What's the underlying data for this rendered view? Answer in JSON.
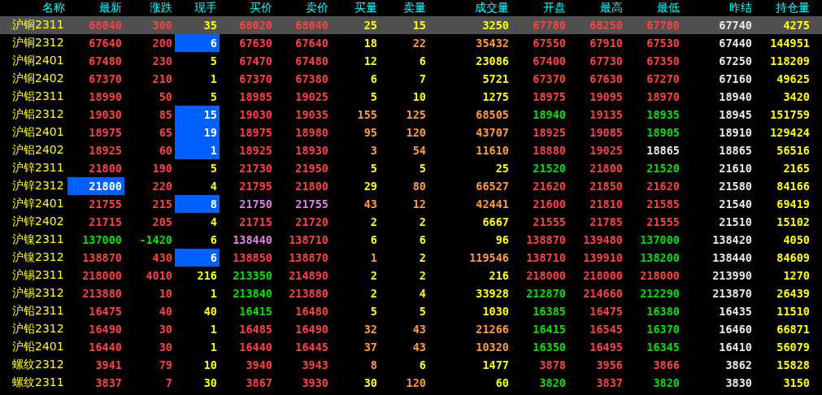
{
  "columns": [
    "名称",
    "最新",
    "涨跌",
    "现手",
    "买价",
    "卖价",
    "买量",
    "卖量",
    "成交量",
    "开盘",
    "最高",
    "最低",
    "昨结",
    "持仓量"
  ],
  "rows": [
    {
      "selected": true,
      "cells": [
        {
          "text": "沪铜2311"
        },
        {
          "text": "68040",
          "color": "#ff4040"
        },
        {
          "text": "300",
          "color": "#ff4040"
        },
        {
          "text": "35",
          "color": "#ffff00"
        },
        {
          "text": "68020",
          "color": "#ff4040"
        },
        {
          "text": "68040",
          "color": "#ff4040"
        },
        {
          "text": "25",
          "color": "#ffff00"
        },
        {
          "text": "15",
          "color": "#ffff00"
        },
        {
          "text": "3250",
          "color": "#ffff00"
        },
        {
          "text": "67780",
          "color": "#ff4040"
        },
        {
          "text": "68250",
          "color": "#ff4040"
        },
        {
          "text": "67780",
          "color": "#ff4040"
        },
        {
          "text": "67740",
          "color": "#e8e8e8"
        },
        {
          "text": "4275",
          "color": "#ffff00"
        }
      ]
    },
    {
      "selected": false,
      "cells": [
        {
          "text": "沪铜2312"
        },
        {
          "text": "67640",
          "color": "#ff4040"
        },
        {
          "text": "200",
          "color": "#ff4040"
        },
        {
          "text": "6",
          "flash": true
        },
        {
          "text": "67630",
          "color": "#ff4040"
        },
        {
          "text": "67640",
          "color": "#ff4040"
        },
        {
          "text": "18",
          "color": "#ffff00"
        },
        {
          "text": "22",
          "color": "#ff9a40"
        },
        {
          "text": "35432",
          "color": "#ff9a40"
        },
        {
          "text": "67550",
          "color": "#ff4040"
        },
        {
          "text": "67910",
          "color": "#ff4040"
        },
        {
          "text": "67530",
          "color": "#ff4040"
        },
        {
          "text": "67440",
          "color": "#e8e8e8"
        },
        {
          "text": "144951",
          "color": "#ffff00"
        }
      ]
    },
    {
      "selected": false,
      "cells": [
        {
          "text": "沪铜2401"
        },
        {
          "text": "67480",
          "color": "#ff4040"
        },
        {
          "text": "230",
          "color": "#ff4040"
        },
        {
          "text": "5",
          "color": "#ffff00"
        },
        {
          "text": "67470",
          "color": "#ff4040"
        },
        {
          "text": "67480",
          "color": "#ff4040"
        },
        {
          "text": "12",
          "color": "#ffff00"
        },
        {
          "text": "6",
          "color": "#ffff00"
        },
        {
          "text": "23086",
          "color": "#ffff00"
        },
        {
          "text": "67400",
          "color": "#ff4040"
        },
        {
          "text": "67730",
          "color": "#ff4040"
        },
        {
          "text": "67350",
          "color": "#ff4040"
        },
        {
          "text": "67250",
          "color": "#e8e8e8"
        },
        {
          "text": "118209",
          "color": "#ffff00"
        }
      ]
    },
    {
      "selected": false,
      "cells": [
        {
          "text": "沪铜2402"
        },
        {
          "text": "67370",
          "color": "#ff4040"
        },
        {
          "text": "210",
          "color": "#ff4040"
        },
        {
          "text": "1",
          "color": "#ffff00"
        },
        {
          "text": "67370",
          "color": "#ff4040"
        },
        {
          "text": "67380",
          "color": "#ff4040"
        },
        {
          "text": "6",
          "color": "#ffff00"
        },
        {
          "text": "7",
          "color": "#ffff00"
        },
        {
          "text": "5721",
          "color": "#ffff00"
        },
        {
          "text": "67370",
          "color": "#ff4040"
        },
        {
          "text": "67630",
          "color": "#ff4040"
        },
        {
          "text": "67270",
          "color": "#ff4040"
        },
        {
          "text": "67160",
          "color": "#e8e8e8"
        },
        {
          "text": "49625",
          "color": "#ffff00"
        }
      ]
    },
    {
      "selected": false,
      "cells": [
        {
          "text": "沪铝2311"
        },
        {
          "text": "18990",
          "color": "#ff4040"
        },
        {
          "text": "50",
          "color": "#ff4040"
        },
        {
          "text": "5",
          "color": "#ffff00"
        },
        {
          "text": "18985",
          "color": "#ff4040"
        },
        {
          "text": "19025",
          "color": "#ff4040"
        },
        {
          "text": "5",
          "color": "#ffff00"
        },
        {
          "text": "10",
          "color": "#ffff00"
        },
        {
          "text": "1275",
          "color": "#ffff00"
        },
        {
          "text": "18975",
          "color": "#ff4040"
        },
        {
          "text": "19095",
          "color": "#ff4040"
        },
        {
          "text": "18970",
          "color": "#ff4040"
        },
        {
          "text": "18940",
          "color": "#e8e8e8"
        },
        {
          "text": "3420",
          "color": "#ffff00"
        }
      ]
    },
    {
      "selected": false,
      "cells": [
        {
          "text": "沪铝2312"
        },
        {
          "text": "19030",
          "color": "#ff4040"
        },
        {
          "text": "85",
          "color": "#ff4040"
        },
        {
          "text": "15",
          "flash": true
        },
        {
          "text": "19030",
          "color": "#ff4040"
        },
        {
          "text": "19035",
          "color": "#ff4040"
        },
        {
          "text": "155",
          "color": "#ff9a40"
        },
        {
          "text": "125",
          "color": "#ff9a40"
        },
        {
          "text": "68505",
          "color": "#ff9a40"
        },
        {
          "text": "18940",
          "color": "#00e000"
        },
        {
          "text": "19135",
          "color": "#ff4040"
        },
        {
          "text": "18935",
          "color": "#00e000"
        },
        {
          "text": "18945",
          "color": "#e8e8e8"
        },
        {
          "text": "151759",
          "color": "#ffff00"
        }
      ]
    },
    {
      "selected": false,
      "cells": [
        {
          "text": "沪铝2401"
        },
        {
          "text": "18975",
          "color": "#ff4040"
        },
        {
          "text": "65",
          "color": "#ff4040"
        },
        {
          "text": "19",
          "flash": true
        },
        {
          "text": "18975",
          "color": "#ff4040"
        },
        {
          "text": "18980",
          "color": "#ff4040"
        },
        {
          "text": "95",
          "color": "#ff9a40"
        },
        {
          "text": "120",
          "color": "#ff9a40"
        },
        {
          "text": "43707",
          "color": "#ff9a40"
        },
        {
          "text": "18925",
          "color": "#ff4040"
        },
        {
          "text": "19085",
          "color": "#ff4040"
        },
        {
          "text": "18905",
          "color": "#00e000"
        },
        {
          "text": "18910",
          "color": "#e8e8e8"
        },
        {
          "text": "129424",
          "color": "#ffff00"
        }
      ]
    },
    {
      "selected": false,
      "cells": [
        {
          "text": "沪铝2402"
        },
        {
          "text": "18925",
          "color": "#ff4040"
        },
        {
          "text": "60",
          "color": "#ff4040"
        },
        {
          "text": "1",
          "flash": true
        },
        {
          "text": "18925",
          "color": "#ff4040"
        },
        {
          "text": "18930",
          "color": "#ff4040"
        },
        {
          "text": "3",
          "color": "#ff9a40"
        },
        {
          "text": "54",
          "color": "#ff9a40"
        },
        {
          "text": "11610",
          "color": "#ff9a40"
        },
        {
          "text": "18880",
          "color": "#ff4040"
        },
        {
          "text": "19025",
          "color": "#ff4040"
        },
        {
          "text": "18865",
          "color": "#e8e8e8"
        },
        {
          "text": "18865",
          "color": "#e8e8e8"
        },
        {
          "text": "56516",
          "color": "#ffff00"
        }
      ]
    },
    {
      "selected": false,
      "cells": [
        {
          "text": "沪锌2311"
        },
        {
          "text": "21800",
          "color": "#ff4040"
        },
        {
          "text": "190",
          "color": "#ff4040"
        },
        {
          "text": "5",
          "color": "#ffff00"
        },
        {
          "text": "21730",
          "color": "#ff4040"
        },
        {
          "text": "21950",
          "color": "#ff4040"
        },
        {
          "text": "5",
          "color": "#ffff00"
        },
        {
          "text": "5",
          "color": "#ffff00"
        },
        {
          "text": "25",
          "color": "#ffff00"
        },
        {
          "text": "21520",
          "color": "#00e000"
        },
        {
          "text": "21800",
          "color": "#ff4040"
        },
        {
          "text": "21520",
          "color": "#00e000"
        },
        {
          "text": "21610",
          "color": "#e8e8e8"
        },
        {
          "text": "2165",
          "color": "#ffff00"
        }
      ]
    },
    {
      "selected": false,
      "cells": [
        {
          "text": "沪锌2312"
        },
        {
          "text": "21800",
          "flash": true
        },
        {
          "text": "220",
          "color": "#ff4040"
        },
        {
          "text": "4",
          "color": "#ffff00"
        },
        {
          "text": "21795",
          "color": "#ff4040"
        },
        {
          "text": "21800",
          "color": "#ff4040"
        },
        {
          "text": "29",
          "color": "#ffff00"
        },
        {
          "text": "80",
          "color": "#ff9a40"
        },
        {
          "text": "66527",
          "color": "#ff9a40"
        },
        {
          "text": "21620",
          "color": "#ff4040"
        },
        {
          "text": "21850",
          "color": "#ff4040"
        },
        {
          "text": "21620",
          "color": "#ff4040"
        },
        {
          "text": "21580",
          "color": "#e8e8e8"
        },
        {
          "text": "84166",
          "color": "#ffff00"
        }
      ]
    },
    {
      "selected": false,
      "cells": [
        {
          "text": "沪锌2401"
        },
        {
          "text": "21755",
          "color": "#ff4040"
        },
        {
          "text": "215",
          "color": "#ff4040"
        },
        {
          "text": "8",
          "flash": true
        },
        {
          "text": "21750",
          "color": "#e080e0"
        },
        {
          "text": "21755",
          "color": "#e080e0"
        },
        {
          "text": "43",
          "color": "#ff9a40"
        },
        {
          "text": "12",
          "color": "#ff9a40"
        },
        {
          "text": "42441",
          "color": "#ff9a40"
        },
        {
          "text": "21600",
          "color": "#ff4040"
        },
        {
          "text": "21810",
          "color": "#ff4040"
        },
        {
          "text": "21585",
          "color": "#ff4040"
        },
        {
          "text": "21540",
          "color": "#e8e8e8"
        },
        {
          "text": "69419",
          "color": "#ffff00"
        }
      ]
    },
    {
      "selected": false,
      "cells": [
        {
          "text": "沪锌2402"
        },
        {
          "text": "21715",
          "color": "#ff4040"
        },
        {
          "text": "205",
          "color": "#ff4040"
        },
        {
          "text": "4",
          "color": "#ffff00"
        },
        {
          "text": "21715",
          "color": "#ff4040"
        },
        {
          "text": "21720",
          "color": "#ff4040"
        },
        {
          "text": "2",
          "color": "#ffff00"
        },
        {
          "text": "2",
          "color": "#ffff00"
        },
        {
          "text": "6667",
          "color": "#ffff00"
        },
        {
          "text": "21555",
          "color": "#ff4040"
        },
        {
          "text": "21785",
          "color": "#ff4040"
        },
        {
          "text": "21555",
          "color": "#ff4040"
        },
        {
          "text": "21510",
          "color": "#e8e8e8"
        },
        {
          "text": "15102",
          "color": "#ffff00"
        }
      ]
    },
    {
      "selected": false,
      "cells": [
        {
          "text": "沪镍2311"
        },
        {
          "text": "137000",
          "color": "#00e000"
        },
        {
          "text": "-1420",
          "color": "#00e000"
        },
        {
          "text": "6",
          "color": "#ffff00"
        },
        {
          "text": "138440",
          "color": "#e080e0"
        },
        {
          "text": "138710",
          "color": "#ff4040"
        },
        {
          "text": "6",
          "color": "#ffff00"
        },
        {
          "text": "6",
          "color": "#ffff00"
        },
        {
          "text": "96",
          "color": "#ffff00"
        },
        {
          "text": "138870",
          "color": "#ff4040"
        },
        {
          "text": "139480",
          "color": "#ff4040"
        },
        {
          "text": "137000",
          "color": "#00e000"
        },
        {
          "text": "138420",
          "color": "#e8e8e8"
        },
        {
          "text": "4050",
          "color": "#ffff00"
        }
      ]
    },
    {
      "selected": false,
      "cells": [
        {
          "text": "沪镍2312"
        },
        {
          "text": "138870",
          "color": "#ff4040"
        },
        {
          "text": "430",
          "color": "#ff4040"
        },
        {
          "text": "6",
          "flash": true
        },
        {
          "text": "138850",
          "color": "#ff4040"
        },
        {
          "text": "138870",
          "color": "#ff4040"
        },
        {
          "text": "1",
          "color": "#ff9a40"
        },
        {
          "text": "2",
          "color": "#ffff00"
        },
        {
          "text": "119546",
          "color": "#ff9a40"
        },
        {
          "text": "138710",
          "color": "#ff4040"
        },
        {
          "text": "139910",
          "color": "#ff4040"
        },
        {
          "text": "138200",
          "color": "#00e000"
        },
        {
          "text": "138440",
          "color": "#e8e8e8"
        },
        {
          "text": "84609",
          "color": "#ffff00"
        }
      ]
    },
    {
      "selected": false,
      "cells": [
        {
          "text": "沪锡2311"
        },
        {
          "text": "218000",
          "color": "#ff4040"
        },
        {
          "text": "4010",
          "color": "#ff4040"
        },
        {
          "text": "216",
          "color": "#ffff00"
        },
        {
          "text": "213350",
          "color": "#00e000"
        },
        {
          "text": "214890",
          "color": "#ff4040"
        },
        {
          "text": "2",
          "color": "#ffff00"
        },
        {
          "text": "2",
          "color": "#ffff00"
        },
        {
          "text": "216",
          "color": "#ffff00"
        },
        {
          "text": "218000",
          "color": "#ff4040"
        },
        {
          "text": "218000",
          "color": "#ff4040"
        },
        {
          "text": "218000",
          "color": "#ff4040"
        },
        {
          "text": "213990",
          "color": "#e8e8e8"
        },
        {
          "text": "1270",
          "color": "#ffff00"
        }
      ]
    },
    {
      "selected": false,
      "cells": [
        {
          "text": "沪锡2312"
        },
        {
          "text": "213880",
          "color": "#ff4040"
        },
        {
          "text": "10",
          "color": "#ff4040"
        },
        {
          "text": "1",
          "color": "#ffff00"
        },
        {
          "text": "213840",
          "color": "#00e000"
        },
        {
          "text": "213880",
          "color": "#ff4040"
        },
        {
          "text": "2",
          "color": "#ffff00"
        },
        {
          "text": "4",
          "color": "#ffff00"
        },
        {
          "text": "33928",
          "color": "#ffff00"
        },
        {
          "text": "212870",
          "color": "#00e000"
        },
        {
          "text": "214660",
          "color": "#ff4040"
        },
        {
          "text": "212290",
          "color": "#00e000"
        },
        {
          "text": "213870",
          "color": "#e8e8e8"
        },
        {
          "text": "26439",
          "color": "#ffff00"
        }
      ]
    },
    {
      "selected": false,
      "cells": [
        {
          "text": "沪铅2311"
        },
        {
          "text": "16475",
          "color": "#ff4040"
        },
        {
          "text": "40",
          "color": "#ff4040"
        },
        {
          "text": "40",
          "color": "#ffff00"
        },
        {
          "text": "16415",
          "color": "#00e000"
        },
        {
          "text": "16480",
          "color": "#ff4040"
        },
        {
          "text": "5",
          "color": "#ffff00"
        },
        {
          "text": "5",
          "color": "#ffff00"
        },
        {
          "text": "1030",
          "color": "#ffff00"
        },
        {
          "text": "16385",
          "color": "#00e000"
        },
        {
          "text": "16475",
          "color": "#ff4040"
        },
        {
          "text": "16380",
          "color": "#00e000"
        },
        {
          "text": "16435",
          "color": "#e8e8e8"
        },
        {
          "text": "11510",
          "color": "#ffff00"
        }
      ]
    },
    {
      "selected": false,
      "cells": [
        {
          "text": "沪铅2312"
        },
        {
          "text": "16490",
          "color": "#ff4040"
        },
        {
          "text": "30",
          "color": "#ff4040"
        },
        {
          "text": "1",
          "color": "#ffff00"
        },
        {
          "text": "16485",
          "color": "#ff4040"
        },
        {
          "text": "16490",
          "color": "#ff4040"
        },
        {
          "text": "32",
          "color": "#ff9a40"
        },
        {
          "text": "43",
          "color": "#ff9a40"
        },
        {
          "text": "21266",
          "color": "#ff9a40"
        },
        {
          "text": "16415",
          "color": "#00e000"
        },
        {
          "text": "16545",
          "color": "#ff4040"
        },
        {
          "text": "16370",
          "color": "#00e000"
        },
        {
          "text": "16460",
          "color": "#e8e8e8"
        },
        {
          "text": "66871",
          "color": "#ffff00"
        }
      ]
    },
    {
      "selected": false,
      "cells": [
        {
          "text": "沪铅2401"
        },
        {
          "text": "16440",
          "color": "#ff4040"
        },
        {
          "text": "30",
          "color": "#ff4040"
        },
        {
          "text": "1",
          "color": "#ffff00"
        },
        {
          "text": "16440",
          "color": "#ff4040"
        },
        {
          "text": "16445",
          "color": "#ff4040"
        },
        {
          "text": "37",
          "color": "#ff9a40"
        },
        {
          "text": "43",
          "color": "#ff9a40"
        },
        {
          "text": "10320",
          "color": "#ff9a40"
        },
        {
          "text": "16350",
          "color": "#00e000"
        },
        {
          "text": "16495",
          "color": "#ff4040"
        },
        {
          "text": "16345",
          "color": "#00e000"
        },
        {
          "text": "16410",
          "color": "#e8e8e8"
        },
        {
          "text": "56079",
          "color": "#ffff00"
        }
      ]
    },
    {
      "selected": false,
      "cells": [
        {
          "text": "螺纹2312"
        },
        {
          "text": "3941",
          "color": "#ff4040"
        },
        {
          "text": "79",
          "color": "#ff4040"
        },
        {
          "text": "10",
          "color": "#ffff00"
        },
        {
          "text": "3940",
          "color": "#ff4040"
        },
        {
          "text": "3943",
          "color": "#ff4040"
        },
        {
          "text": "8",
          "color": "#ff9a40"
        },
        {
          "text": "6",
          "color": "#ffff00"
        },
        {
          "text": "1477",
          "color": "#ffff00"
        },
        {
          "text": "3878",
          "color": "#ff4040"
        },
        {
          "text": "3956",
          "color": "#ff4040"
        },
        {
          "text": "3866",
          "color": "#ff4040"
        },
        {
          "text": "3862",
          "color": "#e8e8e8"
        },
        {
          "text": "15828",
          "color": "#ffff00"
        }
      ]
    },
    {
      "selected": false,
      "cells": [
        {
          "text": "螺纹2311"
        },
        {
          "text": "3837",
          "color": "#ff4040"
        },
        {
          "text": "7",
          "color": "#ff4040"
        },
        {
          "text": "30",
          "color": "#ffff00"
        },
        {
          "text": "3867",
          "color": "#ff4040"
        },
        {
          "text": "3930",
          "color": "#ff4040"
        },
        {
          "text": "30",
          "color": "#ffff00"
        },
        {
          "text": "120",
          "color": "#ff9a40"
        },
        {
          "text": "60",
          "color": "#ffff00"
        },
        {
          "text": "3820",
          "color": "#00e000"
        },
        {
          "text": "3837",
          "color": "#ff4040"
        },
        {
          "text": "3820",
          "color": "#00e000"
        },
        {
          "text": "3830",
          "color": "#e8e8e8"
        },
        {
          "text": "3150",
          "color": "#ffff00"
        }
      ]
    }
  ]
}
